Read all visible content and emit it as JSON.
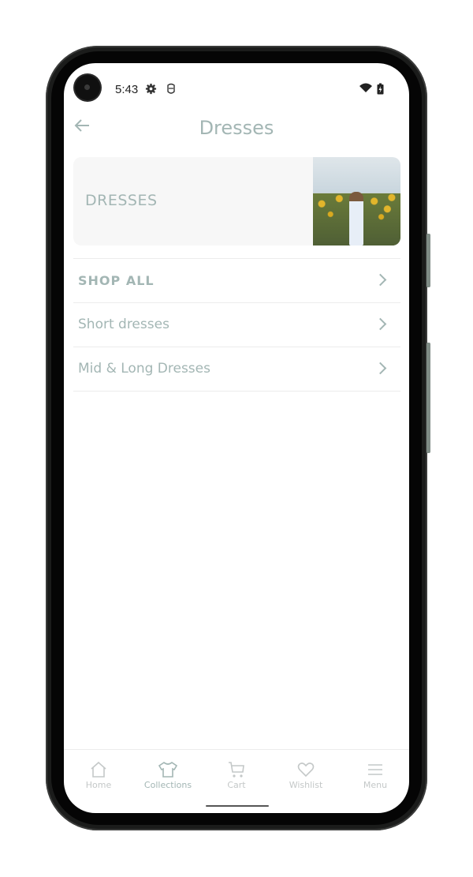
{
  "status_bar": {
    "time": "5:43",
    "left_icons": [
      "gear-icon",
      "shield-icon"
    ],
    "right_icons": [
      "wifi-icon",
      "battery-charging-icon"
    ]
  },
  "header": {
    "back_icon": "arrow-left-icon",
    "title": "Dresses"
  },
  "banner": {
    "label": "DRESSES",
    "image_description": "woman in white dress walking through sunflower field"
  },
  "list": {
    "items": [
      {
        "label": "SHOP ALL",
        "bold": true
      },
      {
        "label": "Short dresses",
        "bold": false
      },
      {
        "label": "Mid & Long Dresses",
        "bold": false
      }
    ]
  },
  "bottom_nav": {
    "active": "Collections",
    "items": [
      {
        "label": "Home",
        "icon": "home-icon"
      },
      {
        "label": "Collections",
        "icon": "tshirt-icon"
      },
      {
        "label": "Cart",
        "icon": "cart-icon"
      },
      {
        "label": "Wishlist",
        "icon": "heart-icon"
      },
      {
        "label": "Menu",
        "icon": "menu-icon"
      }
    ]
  },
  "colors": {
    "accent": "#a3b6b4",
    "inactive_nav": "#c4c8c8",
    "banner_bg": "#f7f7f7",
    "divider": "#ececec"
  }
}
